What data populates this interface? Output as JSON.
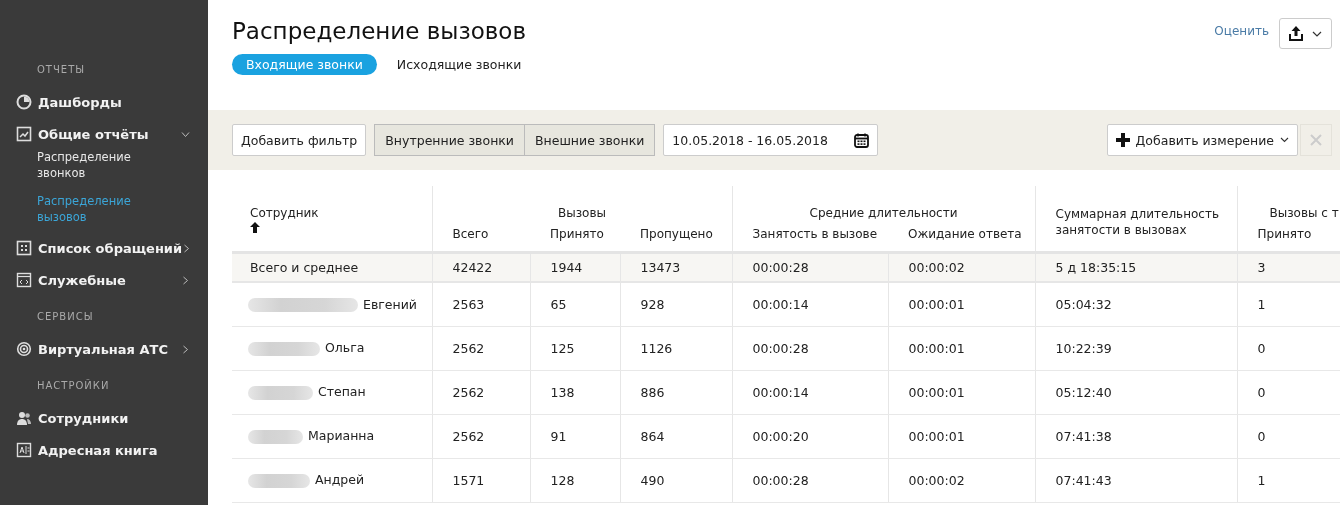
{
  "sidebar": {
    "sections": [
      {
        "label": "ОТЧЕТЫ",
        "items": [
          {
            "label": "Дашборды",
            "kind": "pie"
          },
          {
            "label": "Общие отчёты",
            "kind": "chart",
            "expanded": true,
            "children": [
              {
                "label": "Распределение звонков",
                "selected": false
              },
              {
                "label": "Распределение вызовов",
                "selected": true
              }
            ]
          },
          {
            "label": "Список обращений",
            "kind": "list",
            "expanded": false
          },
          {
            "label": "Служебные",
            "kind": "code",
            "expanded": false
          }
        ]
      },
      {
        "label": "СЕРВИСЫ",
        "items": [
          {
            "label": "Виртуальная АТС",
            "kind": "phone",
            "expanded": false
          }
        ]
      },
      {
        "label": "НАСТРОЙКИ",
        "items": [
          {
            "label": "Сотрудники",
            "kind": "people"
          },
          {
            "label": "Адресная книга",
            "kind": "book"
          }
        ]
      }
    ]
  },
  "header": {
    "title": "Распределение вызовов",
    "rate_link": "Оценить",
    "tabs": [
      {
        "label": "Входящие звонки",
        "selected": true
      },
      {
        "label": "Исходящие звонки",
        "selected": false
      }
    ]
  },
  "toolbar": {
    "add_filter": "Добавить фильтр",
    "segments": [
      {
        "label": "Внутренние звонки",
        "selected": true
      },
      {
        "label": "Внешние звонки",
        "selected": true
      }
    ],
    "date_range": "10.05.2018 - 16.05.2018",
    "add_dimension": "Добавить измерение",
    "remove_disabled": true
  },
  "table": {
    "headers": [
      {
        "label": "Сотрудник",
        "sorted": true
      },
      {
        "label": "Вызовы",
        "children": [
          "Всего",
          "Принято",
          "Пропущено"
        ]
      },
      {
        "label": "Средние длительности",
        "children": [
          "Занятость в вызове",
          "Ожидание ответа"
        ]
      },
      {
        "label": "Суммарная длительность занятости в вызовах"
      },
      {
        "label": "Вызовы с т",
        "children": [
          "Принято"
        ]
      }
    ],
    "total_row": {
      "label": "Всего и среднее",
      "cells": [
        "42422",
        "1944",
        "13473",
        "00:00:28",
        "00:00:02",
        "5 д 18:35:15",
        "3"
      ]
    },
    "rows": [
      {
        "name": "Евгений",
        "redacted": true,
        "cells": [
          "2563",
          "65",
          "928",
          "00:00:14",
          "00:00:01",
          "05:04:32",
          "1"
        ]
      },
      {
        "name": "Ольга",
        "redacted": true,
        "cells": [
          "2562",
          "125",
          "1126",
          "00:00:28",
          "00:00:01",
          "10:22:39",
          "0"
        ]
      },
      {
        "name": "Степан",
        "redacted": true,
        "cells": [
          "2562",
          "138",
          "886",
          "00:00:14",
          "00:00:01",
          "05:12:40",
          "0"
        ]
      },
      {
        "name": "Марианна",
        "redacted": true,
        "cells": [
          "2562",
          "91",
          "864",
          "00:00:20",
          "00:00:01",
          "07:41:38",
          "0"
        ]
      },
      {
        "name": "Андрей",
        "redacted": true,
        "cells": [
          "1571",
          "128",
          "490",
          "00:00:28",
          "00:00:02",
          "07:41:43",
          "1"
        ]
      }
    ]
  }
}
